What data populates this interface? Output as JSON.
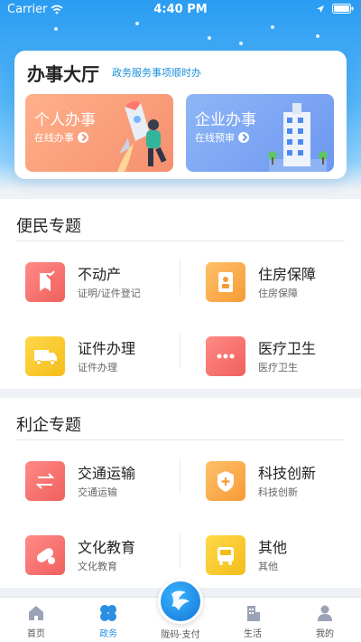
{
  "status": {
    "carrier": "Carrier",
    "time": "4:40 PM"
  },
  "hall": {
    "title": "办事大厅",
    "subtitle": "政务服务事项顺时办",
    "personal": {
      "title": "个人办事",
      "sub": "在线办事"
    },
    "company": {
      "title": "企业办事",
      "sub": "在线预审"
    }
  },
  "sections": {
    "bianmin": {
      "title": "便民专题",
      "items": [
        {
          "name": "不动产",
          "desc": "证明/证件登记",
          "icon": "document-stamp-icon",
          "color": "#f0605e"
        },
        {
          "name": "住房保障",
          "desc": "住房保障",
          "icon": "id-badge-icon",
          "color": "#f79b36"
        },
        {
          "name": "证件办理",
          "desc": "证件办理",
          "icon": "truck-icon",
          "color": "#f4bd1a"
        },
        {
          "name": "医疗卫生",
          "desc": "医疗卫生",
          "icon": "more-dots-icon",
          "color": "#f0605e"
        }
      ]
    },
    "liqi": {
      "title": "利企专题",
      "items": [
        {
          "name": "交通运输",
          "desc": "交通运输",
          "icon": "swap-arrows-icon",
          "color": "#f0605e"
        },
        {
          "name": "科技创新",
          "desc": "科技创新",
          "icon": "shield-plus-icon",
          "color": "#f79b36"
        },
        {
          "name": "文化教育",
          "desc": "文化教育",
          "icon": "pill-icon",
          "color": "#f0605e"
        },
        {
          "name": "其他",
          "desc": "其他",
          "icon": "bus-icon",
          "color": "#f4bd1a"
        }
      ]
    }
  },
  "tabbar": {
    "home": "首页",
    "gov": "政务",
    "pay": "陇码·支付",
    "life": "生活",
    "mine": "我的"
  },
  "colors": {
    "accent": "#2a8fe0"
  }
}
